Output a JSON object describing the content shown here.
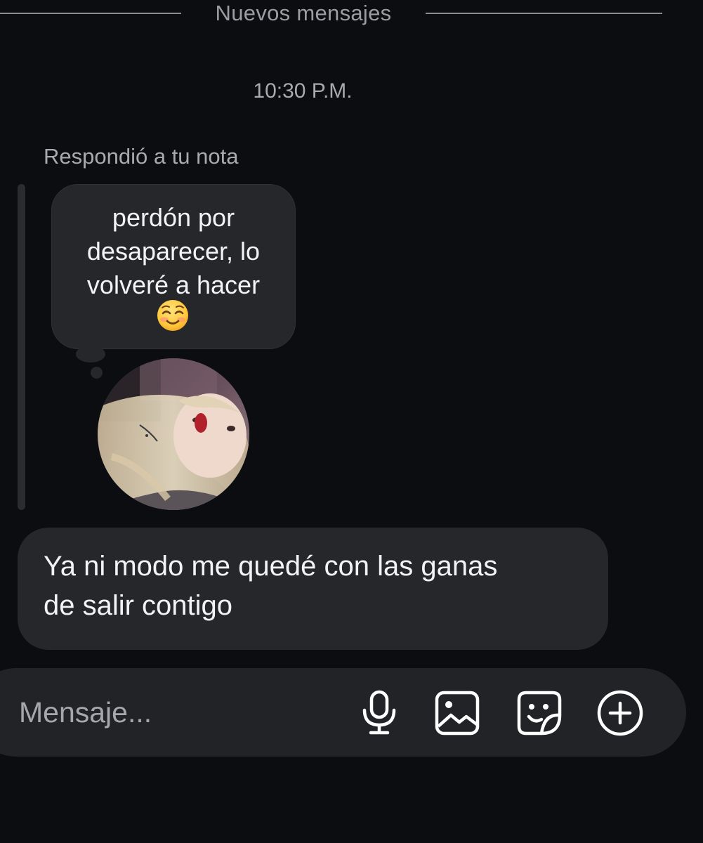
{
  "divider": {
    "label": "Nuevos mensajes"
  },
  "timestamp": "10:30 P.M.",
  "reply": {
    "caption": "Respondió a tu nota",
    "note_text_lines": [
      "perdón por",
      "desaparecer, lo",
      "volveré a hacer"
    ],
    "note_emoji_icon": "smiling-blush-emoji-icon",
    "avatar_image": "profile-photo-avatar"
  },
  "message": {
    "text_lines": [
      "Ya ni modo me quedé con las ganas",
      "de salir contigo"
    ]
  },
  "composer": {
    "placeholder": "Mensaje...",
    "icons": [
      "microphone-icon",
      "gallery-icon",
      "sticker-icon",
      "plus-circle-icon"
    ]
  },
  "colors": {
    "background": "#0b0d11",
    "bubble": "#25272b",
    "composer": "#212327",
    "text_primary": "#f2f3f5",
    "text_secondary": "#a7aab0"
  }
}
